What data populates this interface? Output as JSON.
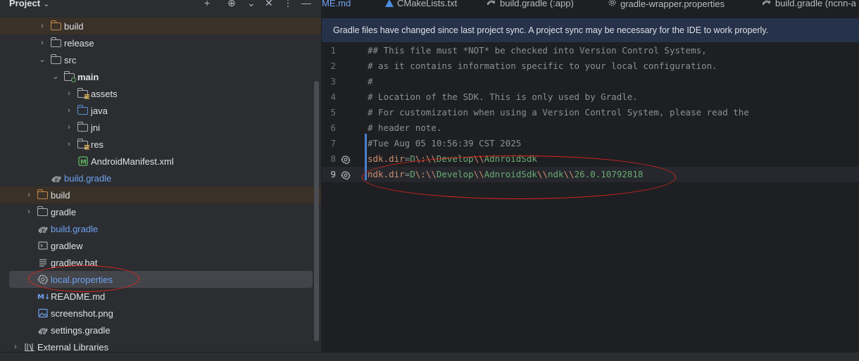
{
  "project_panel": {
    "title": "Project",
    "tree": [
      {
        "label": "build",
        "depth": 3,
        "arrow": "›",
        "icon": "folder-orange",
        "excluded": true
      },
      {
        "label": "release",
        "depth": 3,
        "arrow": "›",
        "icon": "folder"
      },
      {
        "label": "src",
        "depth": 3,
        "arrow": "⌄",
        "icon": "folder"
      },
      {
        "label": "main",
        "depth": 4,
        "arrow": "⌄",
        "icon": "folder-module",
        "bold": true
      },
      {
        "label": "assets",
        "depth": 5,
        "arrow": "›",
        "icon": "folder-resources"
      },
      {
        "label": "java",
        "depth": 5,
        "arrow": "›",
        "icon": "folder-blue"
      },
      {
        "label": "jni",
        "depth": 5,
        "arrow": "›",
        "icon": "folder"
      },
      {
        "label": "res",
        "depth": 5,
        "arrow": "›",
        "icon": "folder-resources"
      },
      {
        "label": "AndroidManifest.xml",
        "depth": 5,
        "arrow": "",
        "icon": "manifest"
      },
      {
        "label": "build.gradle",
        "depth": 3,
        "arrow": "",
        "icon": "gradle",
        "blue": true
      },
      {
        "label": "build",
        "depth": 2,
        "arrow": "›",
        "icon": "folder-orange",
        "excluded": true
      },
      {
        "label": "gradle",
        "depth": 2,
        "arrow": "›",
        "icon": "folder"
      },
      {
        "label": "build.gradle",
        "depth": 2,
        "arrow": "",
        "icon": "gradle",
        "blue": true
      },
      {
        "label": "gradlew",
        "depth": 2,
        "arrow": "",
        "icon": "terminal"
      },
      {
        "label": "gradlew.bat",
        "depth": 2,
        "arrow": "",
        "icon": "text-file"
      },
      {
        "label": "local.properties",
        "depth": 2,
        "arrow": "",
        "icon": "settings",
        "blue": true,
        "selected": true
      },
      {
        "label": "README.md",
        "depth": 2,
        "arrow": "",
        "icon": "markdown"
      },
      {
        "label": "screenshot.png",
        "depth": 2,
        "arrow": "",
        "icon": "image"
      },
      {
        "label": "settings.gradle",
        "depth": 2,
        "arrow": "",
        "icon": "gradle"
      },
      {
        "label": "External Libraries",
        "depth": 1,
        "arrow": "›",
        "icon": "library"
      }
    ]
  },
  "tabs": [
    {
      "label": "ME.md",
      "icon": "",
      "blue": true
    },
    {
      "label": "CMakeLists.txt",
      "icon": "cmake"
    },
    {
      "label": "build.gradle (:app)",
      "icon": "gradle"
    },
    {
      "label": "gradle-wrapper.properties",
      "icon": "settings"
    },
    {
      "label": "build.gradle (ncnn-a",
      "icon": "gradle"
    }
  ],
  "banner": {
    "text": "Gradle files have changed since last project sync. A project sync may be necessary for the IDE to work properly."
  },
  "editor": {
    "lines": [
      {
        "num": "1",
        "text": "## This file must *NOT* be checked into Version Control Systems,"
      },
      {
        "num": "2",
        "text": "# as it contains information specific to your local configuration."
      },
      {
        "num": "3",
        "text": "#"
      },
      {
        "num": "4",
        "text": "# Location of the SDK. This is only used by Gradle."
      },
      {
        "num": "5",
        "text": "# For customization when using a Version Control System, please read the"
      },
      {
        "num": "6",
        "text": "# header note."
      },
      {
        "num": "7",
        "text": "#Tue Aug 05 10:56:39 CST 2025"
      },
      {
        "num": "8",
        "key": "sdk.dir",
        "parts": [
          "D",
          "\\:",
          "\\\\",
          "Develop",
          "\\\\",
          "AdnroidSdk"
        ]
      },
      {
        "num": "9",
        "key": "ndk.dir",
        "parts": [
          "D",
          "\\:",
          "\\\\",
          "Develop",
          "\\\\",
          "AdnroidSdk",
          "\\\\",
          "ndk",
          "\\\\",
          "26.0.10792818"
        ]
      }
    ],
    "current_line": "9"
  },
  "colors": {
    "accent": "#6fa2f2",
    "annotation_ring": "#e0251f"
  }
}
